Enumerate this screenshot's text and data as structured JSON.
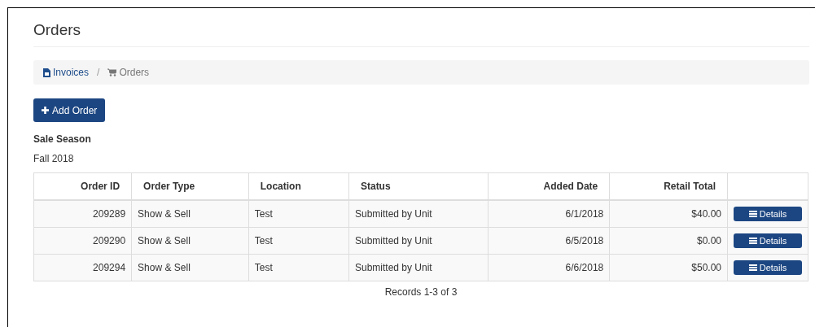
{
  "page_title": "Orders",
  "breadcrumb": [
    {
      "label": "Invoices",
      "kind": "link"
    },
    {
      "label": "Orders",
      "kind": "current"
    }
  ],
  "breadcrumb_separator": "/",
  "add_button": "Add Order",
  "sale_season": {
    "label": "Sale Season",
    "value": "Fall 2018"
  },
  "table": {
    "columns": [
      {
        "label": "Order ID",
        "kind": "number"
      },
      {
        "label": "Order Type",
        "kind": "text"
      },
      {
        "label": "Location",
        "kind": "text"
      },
      {
        "label": "Status",
        "kind": "text"
      },
      {
        "label": "Added Date",
        "kind": "number"
      },
      {
        "label": "Retail Total",
        "kind": "number"
      }
    ],
    "rows": [
      {
        "cells": [
          "209289",
          "Show & Sell",
          "Test",
          "Submitted by Unit",
          "6/1/2018",
          "$40.00"
        ],
        "action": "Details"
      },
      {
        "cells": [
          "209290",
          "Show & Sell",
          "Test",
          "Submitted by Unit",
          "6/5/2018",
          "$0.00"
        ],
        "action": "Details"
      },
      {
        "cells": [
          "209294",
          "Show & Sell",
          "Test",
          "Submitted by Unit",
          "6/6/2018",
          "$50.00"
        ],
        "action": "Details"
      }
    ]
  },
  "records": "Records 1-3 of 3"
}
